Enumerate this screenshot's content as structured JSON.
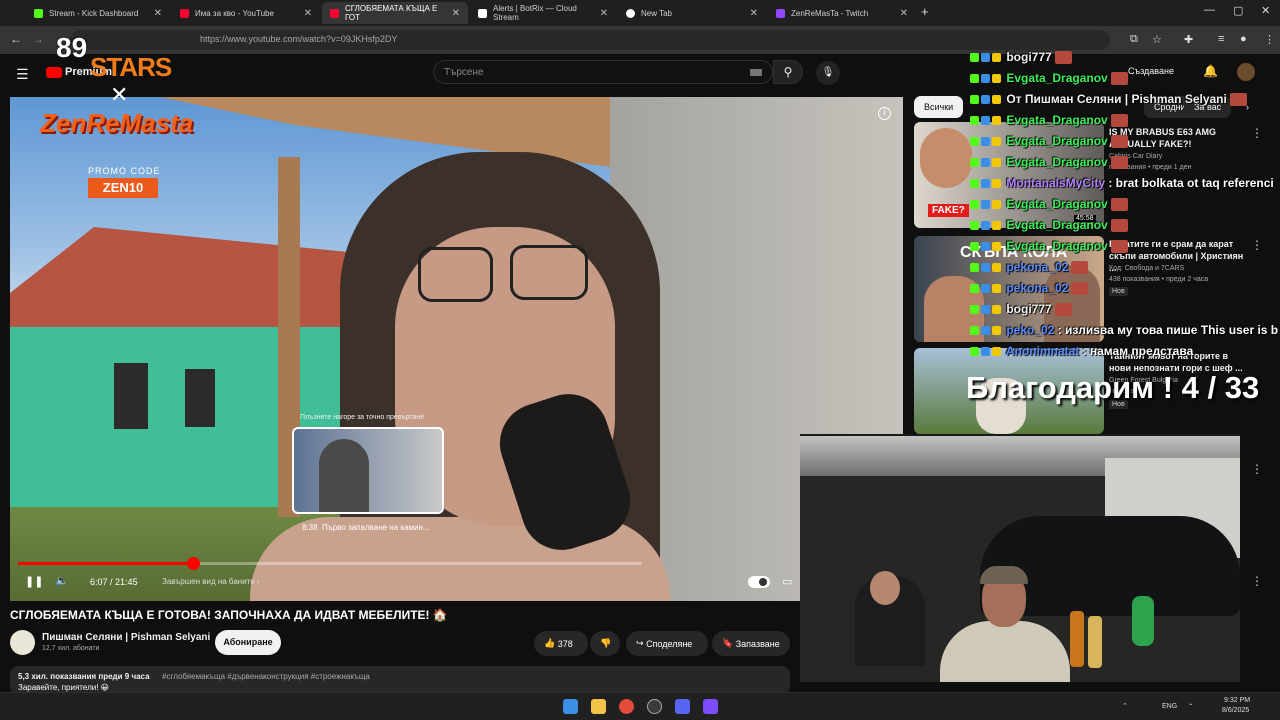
{
  "browser": {
    "tabs": [
      {
        "label": "Stream - Kick Dashboard",
        "color": "#53fc18"
      },
      {
        "label": "Има за кво - YouTube",
        "color": "#ff0033"
      },
      {
        "label": "СГЛОБЯЕМАТА КЪЩА Е ГОТ",
        "color": "#ff0033"
      },
      {
        "label": "Alerts | BotRix — Cloud Stream",
        "color": "#ffffff"
      },
      {
        "label": "New Tab",
        "color": "#ffffff"
      },
      {
        "label": "ZenReMasTa - Twitch",
        "color": "#9146ff"
      }
    ],
    "url": "https://www.youtube.com/watch?v=09JKHsfp2DY"
  },
  "youtube": {
    "logo_text": "Premium",
    "search_placeholder": "Търсене",
    "create_label": "Създаване",
    "video": {
      "title": "СГЛОБЯЕМАТА КЪЩА Е ГОТОВА! ЗАПОЧНАХА ДА ИДВАТ МЕБЕЛИТЕ! 🏠",
      "current_time": "6:07",
      "duration": "21:45",
      "progress_fraction": 0.28,
      "chapter": "Завършен вид на баните",
      "preview_time": "8:38",
      "preview_title": "Първо запалване на камин...",
      "preview_hint": "Плъзнете нагоре за точно превъртане"
    },
    "channel": {
      "name": "Пишман Селяни | Pishman Selyani",
      "subscribers": "12,7 хил. абонати",
      "subscribe_label": "Абониране"
    },
    "actions": {
      "likes": "378",
      "share": "Споделяне",
      "save": "Запазване"
    },
    "description": {
      "views": "5,3 хил. показвания  преди 9 часа",
      "tags": "#сглобяемакъща #дървенаконструкция #строежнакъща",
      "first_line": "Заравейте, приятели! 😀"
    },
    "chips": [
      "Всички",
      "Сродни",
      "За вас"
    ],
    "recommendations": [
      {
        "title": "IS MY BRABUS E63 AMG ACTUALLY FAKE?!",
        "channel": "Cahiris Car Diary",
        "meta": "показвания • преди 1 ден",
        "duration": "45:58",
        "thumb_text": "FAKE?"
      },
      {
        "title": "Богатите ги е срам да карат скъпи автомобили | Християн ...",
        "channel": "Код: Свобода и 7CARS",
        "meta": "438 показвания • преди 2 часа",
        "badge": "Нов",
        "thumb_text": "СКЪПА КОЛА"
      },
      {
        "title": "Тайният живот на горите в нови непознати гори с шеф ...",
        "channel": "Green Forest Bulgaria",
        "meta": "показвания",
        "badge": "Нов"
      }
    ]
  },
  "stream_overlay": {
    "brand_number": "89",
    "brand_word": "STARS",
    "streamer_logo": "ZenReMasta",
    "promo_label": "PROMO CODE",
    "promo_code": "ZEN10",
    "thanks_text": "Благодарим ! 4 / 33",
    "chat": [
      {
        "user": "bogi777",
        "color": "#f1f1f1",
        "message": ""
      },
      {
        "user": "Evgata_Draganov",
        "color": "#3df05a",
        "message": ""
      },
      {
        "user": "От Пишман Селяни | Pishman Selyani",
        "color": "#f1f1f1",
        "message": ""
      },
      {
        "user": "Evgata_Draganov",
        "color": "#3df05a",
        "message": ""
      },
      {
        "user": "Evgata_Draganov",
        "color": "#3df05a",
        "message": ""
      },
      {
        "user": "Evgata_Draganov",
        "color": "#3df05a",
        "message": ""
      },
      {
        "user": "MontanaIsMyCity",
        "color": "#b084ff",
        "message": ": brat bolkata ot taq referenci"
      },
      {
        "user": "Evgata_Draganov",
        "color": "#3df05a",
        "message": ""
      },
      {
        "user": "Evgata_Draganov",
        "color": "#3df05a",
        "message": ""
      },
      {
        "user": "Evgata_Draganov",
        "color": "#3df05a",
        "message": ""
      },
      {
        "user": "pekona_02",
        "color": "#5a8cff",
        "message": ""
      },
      {
        "user": "pekona_02",
        "color": "#5a8cff",
        "message": ""
      },
      {
        "user": "bogi777",
        "color": "#f1f1f1",
        "message": ""
      },
      {
        "user": "peko_02",
        "color": "#5a8cff",
        "message": ": излиsва му това пише This user is b"
      },
      {
        "user": "Anonimnatat",
        "color": "#5a8cff",
        "message": ": намам представа"
      }
    ]
  },
  "taskbar": {
    "language": "ENG",
    "time": "9:32 PM",
    "date": "8/6/2025"
  }
}
